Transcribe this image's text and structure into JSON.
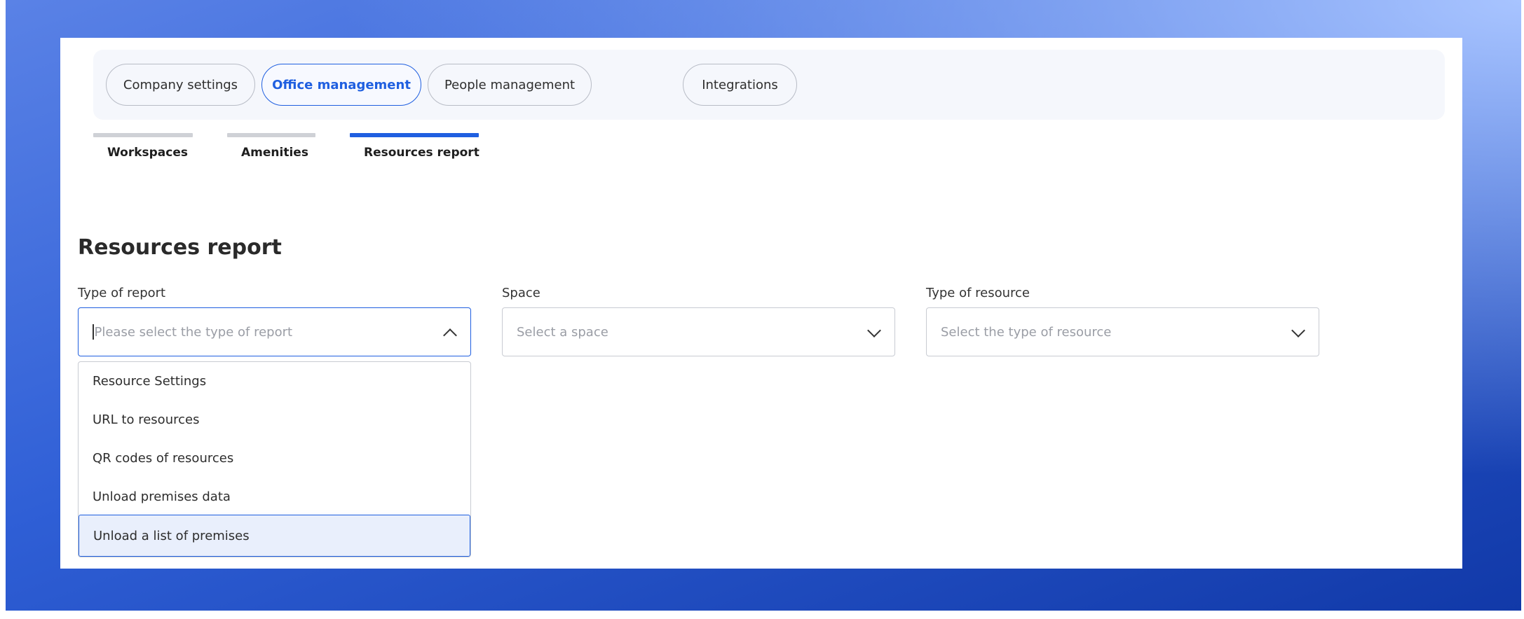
{
  "nav": {
    "pills": [
      {
        "label": "Company settings"
      },
      {
        "label": "Office management"
      },
      {
        "label": "People management"
      },
      {
        "label": "Integrations"
      }
    ]
  },
  "subtabs": [
    {
      "label": "Workspaces"
    },
    {
      "label": "Amenities"
    },
    {
      "label": "Resources report"
    }
  ],
  "page": {
    "title": "Resources report"
  },
  "filters": {
    "report_type": {
      "label": "Type of report",
      "placeholder": "Please select the type of report",
      "options": [
        "Resource Settings",
        "URL to resources",
        "QR codes of resources",
        "Unload premises data",
        "Unload a list of premises"
      ]
    },
    "space": {
      "label": "Space",
      "placeholder": "Select a space"
    },
    "resource_type": {
      "label": "Type of resource",
      "placeholder": "Select the type of resource"
    }
  },
  "colors": {
    "accent": "#1f5fe0",
    "nav_bg": "#f5f7fc",
    "highlight_bg": "#e9effc"
  }
}
